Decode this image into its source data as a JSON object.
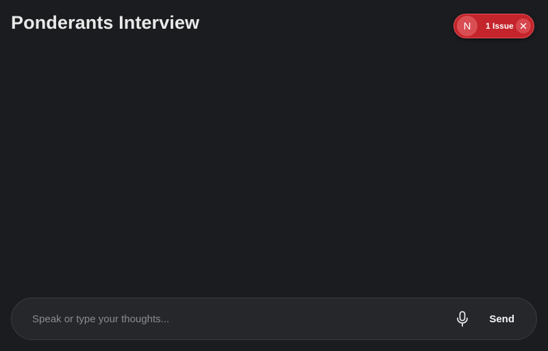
{
  "header": {
    "title": "Ponderants Interview"
  },
  "dev_badge": {
    "logo_letter": "N",
    "issues_label": "1 Issue",
    "logo_icon": "nextjs-logo-icon",
    "close_icon": "close-icon",
    "color": "#c4242b"
  },
  "composer": {
    "placeholder": "Speak or type your thoughts...",
    "value": "",
    "mic_icon": "microphone-icon",
    "send_label": "Send"
  },
  "theme": {
    "background": "#1b1c1f",
    "surface": "#26272b"
  }
}
